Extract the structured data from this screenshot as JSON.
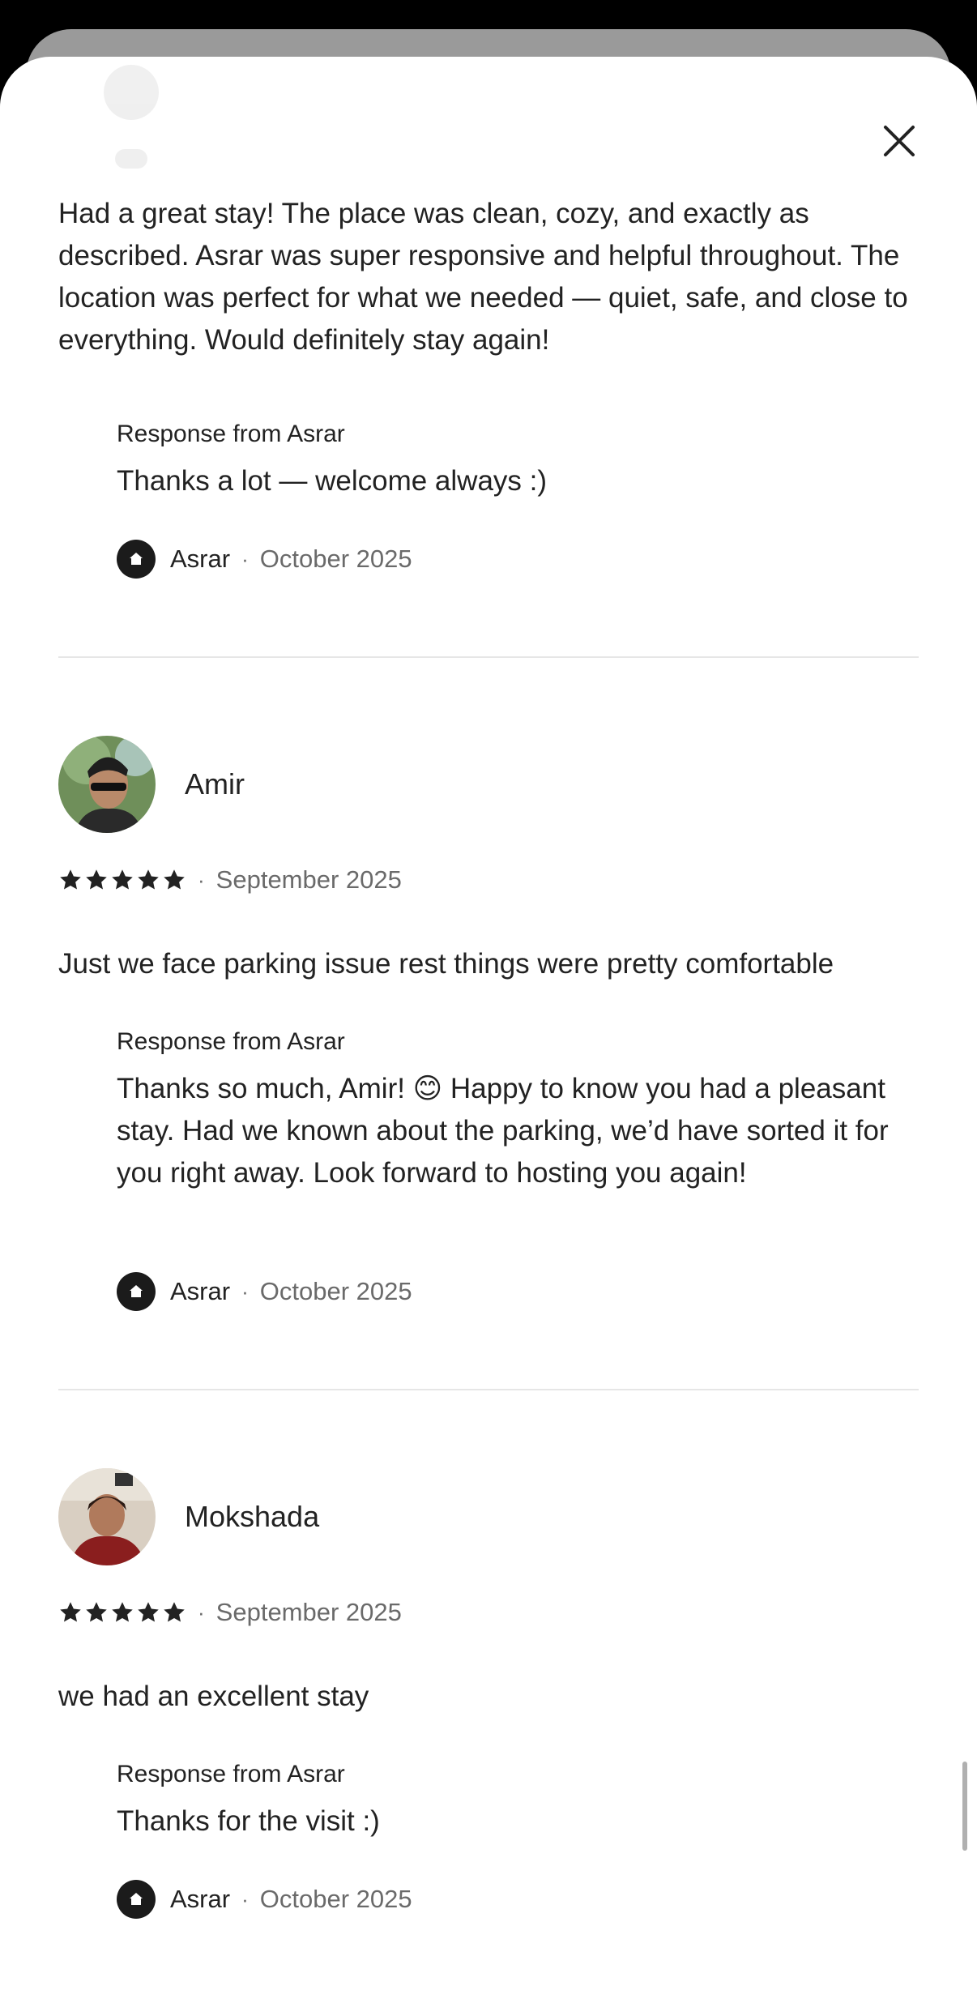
{
  "dialog": {
    "close_icon": "close-icon"
  },
  "reviews": [
    {
      "text": "Had a great stay! The place was clean, cozy, and exactly as described. Asrar was super responsive and helpful throughout. The location was perfect for what we needed — quiet, safe, and close to everything. Would definitely stay again!",
      "response": {
        "title": "Response from Asrar",
        "text": "Thanks a lot — welcome always :)",
        "host": "Asrar",
        "date": "October 2025"
      }
    },
    {
      "name": "Amir",
      "rating": 5,
      "date": "September 2025",
      "text": "Just we face parking issue rest things were pretty comfortable",
      "response": {
        "title": "Response from Asrar",
        "text": "Thanks so much, Amir! 😊 Happy to know you had a pleasant stay. Had we known about the parking, we’d have sorted it for you right away. Look forward to hosting you again!",
        "host": "Asrar",
        "date": "October 2025"
      }
    },
    {
      "name": "Mokshada",
      "rating": 5,
      "date": "September 2025",
      "text": "we had an excellent stay",
      "response": {
        "title": "Response from Asrar",
        "text": "Thanks for the visit :)",
        "host": "Asrar",
        "date": "October 2025"
      }
    }
  ],
  "separator": "·",
  "colors": {
    "text": "#222222",
    "muted": "#6a6a6a",
    "divider": "#e6e6e6"
  }
}
